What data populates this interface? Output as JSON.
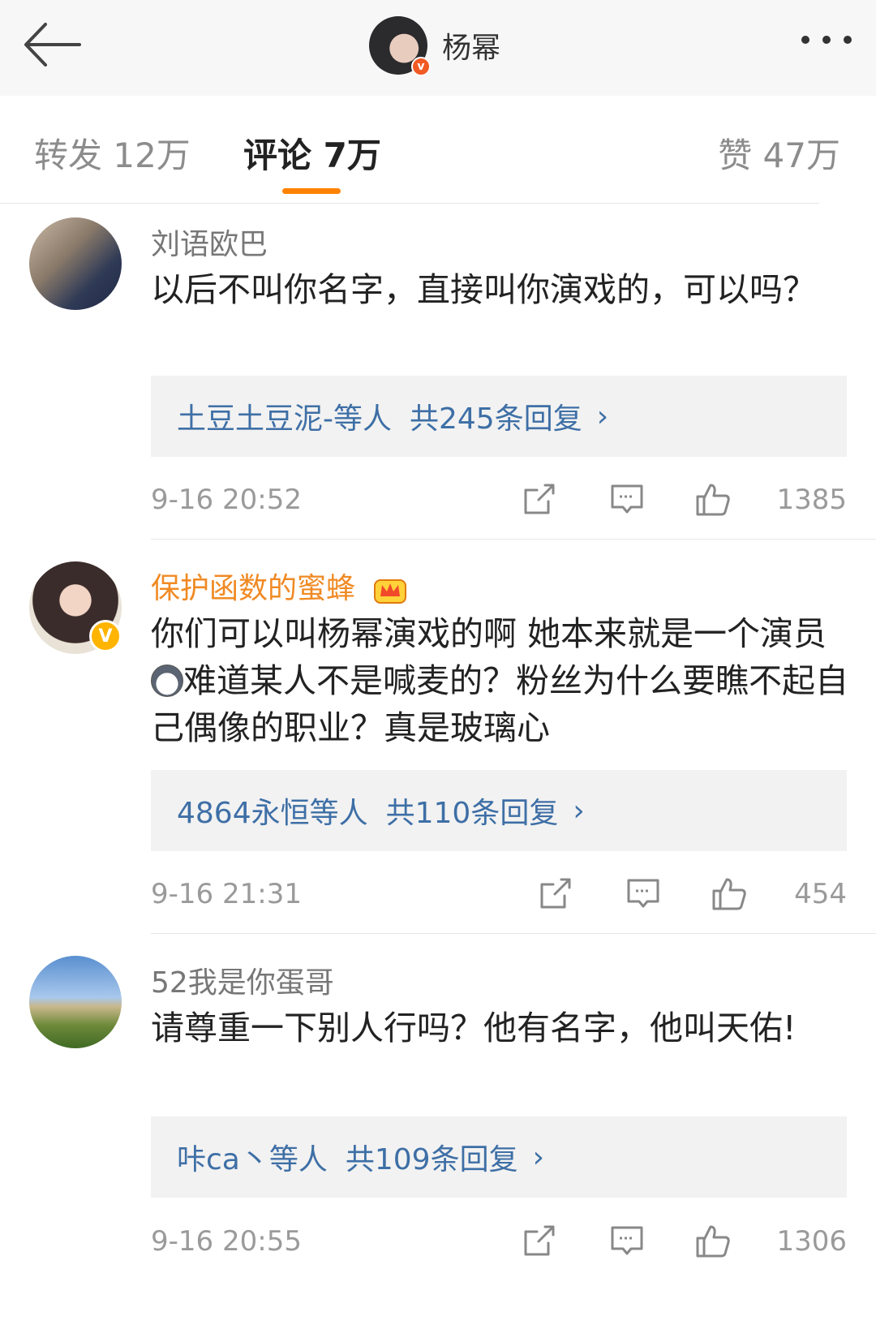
{
  "header": {
    "title": "杨幂",
    "avatar_badge": "v",
    "icons": {
      "back": "back-arrow-icon",
      "more": "more-dots-icon"
    }
  },
  "tabs": [
    {
      "label": "转发 12万"
    },
    {
      "label": "评论 7万",
      "active": true
    },
    {
      "label": "赞 47万"
    }
  ],
  "comments": [
    {
      "username": "刘语欧巴",
      "content": "以后不叫你名字，直接叫你演戏的，可以吗？",
      "reply_who": "土豆土豆泥-等人",
      "reply_count": "共245条回复",
      "time": "9-16 20:52",
      "likes": "1385"
    },
    {
      "username": "保护函数的蜜蜂",
      "vip": true,
      "verified_badge": "V",
      "content_a": "你们可以叫杨幂演戏的啊 她本来就是一个演员",
      "content_b": "难道某人不是喊麦的？粉丝为什么要瞧不起自己偶像的职业？真是玻璃心",
      "reply_who": "4864永恒等人",
      "reply_count": "共110条回复",
      "time": "9-16 21:31",
      "likes": "454"
    },
    {
      "username": "52我是你蛋哥",
      "content": "请尊重一下别人行吗？他有名字，他叫天佑!",
      "reply_who": "咔ca丶等人",
      "reply_count": "共109条回复",
      "time": "9-16 20:55",
      "likes": "1306"
    }
  ],
  "chevron": "›",
  "accent_color": "#ff8200",
  "link_color": "#3e6fa6"
}
